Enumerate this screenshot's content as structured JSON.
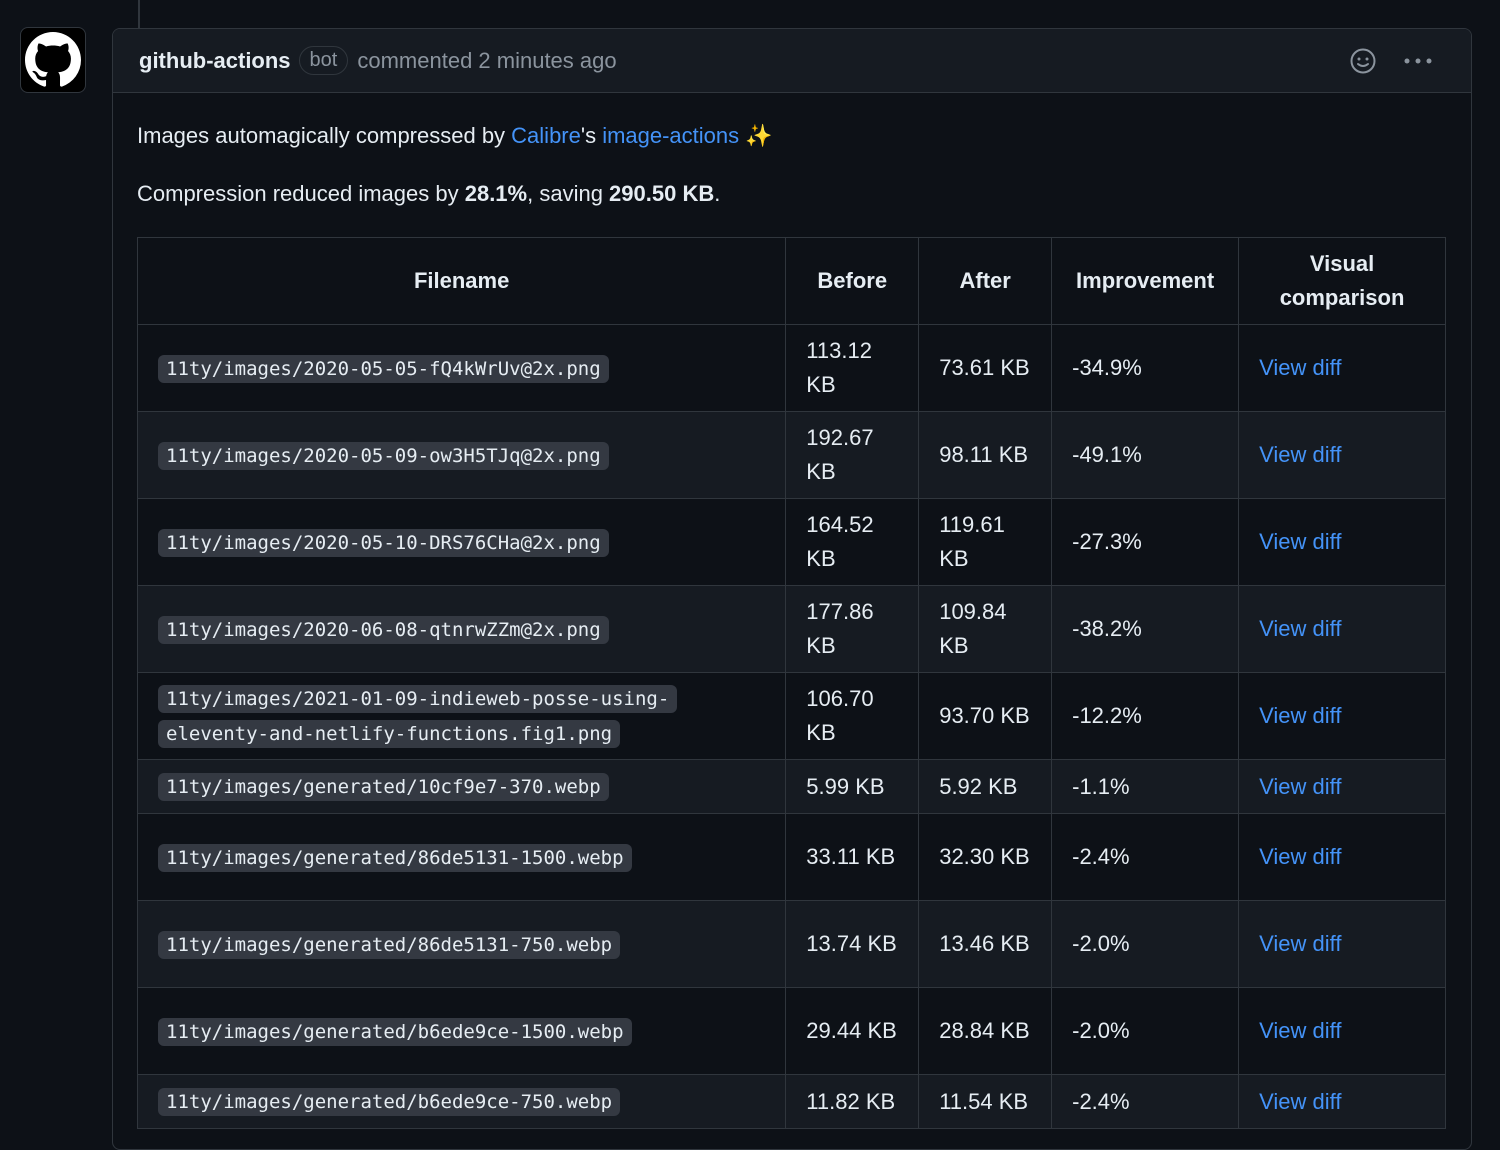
{
  "comment": {
    "author": "github-actions",
    "badge": "bot",
    "meta": "commented 2 minutes ago",
    "intro_prefix": "Images automagically compressed by ",
    "intro_link1": "Calibre",
    "intro_mid": "'s ",
    "intro_link2": "image-actions",
    "intro_sparkle": "✨",
    "summary_prefix": "Compression reduced images by ",
    "summary_percent": "28.1%",
    "summary_mid": ", saving ",
    "summary_saved": "290.50 KB",
    "summary_suffix": "."
  },
  "table": {
    "headers": [
      "Filename",
      "Before",
      "After",
      "Improvement",
      "Visual comparison"
    ],
    "rows": [
      {
        "filename": "11ty/images/2020-05-05-fQ4kWrUv@2x.png",
        "before": "113.12 KB",
        "after": "73.61 KB",
        "improvement": "-34.9%",
        "link": "View diff"
      },
      {
        "filename": "11ty/images/2020-05-09-ow3H5TJq@2x.png",
        "before": "192.67 KB",
        "after": "98.11 KB",
        "improvement": "-49.1%",
        "link": "View diff"
      },
      {
        "filename": "11ty/images/2020-05-10-DRS76CHa@2x.png",
        "before": "164.52 KB",
        "after": "119.61 KB",
        "improvement": "-27.3%",
        "link": "View diff"
      },
      {
        "filename": "11ty/images/2020-06-08-qtnrwZZm@2x.png",
        "before": "177.86 KB",
        "after": "109.84 KB",
        "improvement": "-38.2%",
        "link": "View diff"
      },
      {
        "filename": "11ty/images/2021-01-09-indieweb-posse-using-eleventy-and-netlify-functions.fig1.png",
        "before": "106.70 KB",
        "after": "93.70 KB",
        "improvement": "-12.2%",
        "link": "View diff"
      },
      {
        "filename": "11ty/images/generated/10cf9e7-370.webp",
        "before": "5.99 KB",
        "after": "5.92 KB",
        "improvement": "-1.1%",
        "link": "View diff"
      },
      {
        "filename": "11ty/images/generated/86de5131-1500.webp",
        "before": "33.11 KB",
        "after": "32.30 KB",
        "improvement": "-2.4%",
        "link": "View diff"
      },
      {
        "filename": "11ty/images/generated/86de5131-750.webp",
        "before": "13.74 KB",
        "after": "13.46 KB",
        "improvement": "-2.0%",
        "link": "View diff"
      },
      {
        "filename": "11ty/images/generated/b6ede9ce-1500.webp",
        "before": "29.44 KB",
        "after": "28.84 KB",
        "improvement": "-2.0%",
        "link": "View diff"
      },
      {
        "filename": "11ty/images/generated/b6ede9ce-750.webp",
        "before": "11.82 KB",
        "after": "11.54 KB",
        "improvement": "-2.4%",
        "link": "View diff"
      }
    ]
  }
}
